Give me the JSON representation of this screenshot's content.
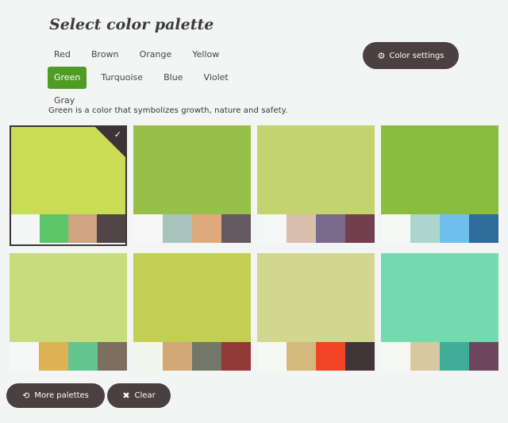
{
  "title": "Select color palette",
  "tabs": [
    "Red",
    "Brown",
    "Orange",
    "Yellow",
    "Green",
    "Turquoise",
    "Blue",
    "Violet",
    "Gray"
  ],
  "active_tab": "Green",
  "settings_label": "Color settings",
  "description": "Green is a color that symbolizes growth, nature and safety.",
  "palettes": [
    {
      "main": "#c8dd55",
      "swatches": [
        "#f4f6f5",
        "#5bc667",
        "#cfa482",
        "#514546"
      ],
      "selected": true
    },
    {
      "main": "#97c04b",
      "swatches": [
        "#f6f6f6",
        "#a8c2bc",
        "#dfa97c",
        "#655a62"
      ],
      "selected": false
    },
    {
      "main": "#c3d36e",
      "swatches": [
        "#f5f7f6",
        "#d9bfad",
        "#7a6a8c",
        "#733f4e"
      ],
      "selected": false
    },
    {
      "main": "#89bd3e",
      "swatches": [
        "#f6f8f4",
        "#aed4ce",
        "#6fbfec",
        "#2e6c9b"
      ],
      "selected": false
    },
    {
      "main": "#c8dc7e",
      "swatches": [
        "#f5f8f6",
        "#deb254",
        "#63c58d",
        "#7d6f60"
      ],
      "selected": false
    },
    {
      "main": "#c3cf52",
      "swatches": [
        "#f3f6ec",
        "#d2a877",
        "#73776a",
        "#923a38"
      ],
      "selected": false
    },
    {
      "main": "#d1d78e",
      "swatches": [
        "#f6f8f5",
        "#d3b97c",
        "#f14426",
        "#423538"
      ],
      "selected": false
    },
    {
      "main": "#73d9ae",
      "swatches": [
        "#f4f7f4",
        "#d8c8a0",
        "#3fad98",
        "#6b465c"
      ],
      "selected": false
    }
  ],
  "more_label": "More palettes",
  "clear_label": "Clear",
  "colors": {
    "accent": "#4e9c24",
    "button": "#4a3f41",
    "background": "#f3f5f4"
  }
}
